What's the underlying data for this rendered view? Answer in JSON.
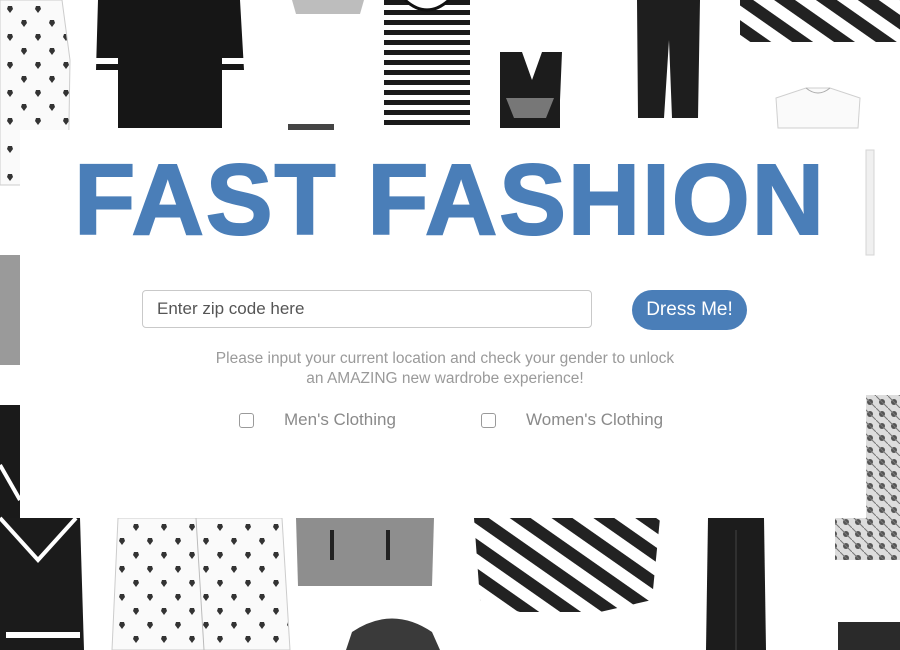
{
  "hero": {
    "title": "FAST FASHION"
  },
  "search": {
    "placeholder": "Enter zip code here",
    "value": "",
    "submit_label": "Dress Me!"
  },
  "description": {
    "line1": "Please input your current location and check your gender to unlock",
    "line2": "an AMAZING new wardrobe experience!"
  },
  "options": [
    {
      "label": "Men's Clothing",
      "checked": false
    },
    {
      "label": "Women's Clothing",
      "checked": false
    }
  ],
  "colors": {
    "accent": "#4a7eb8",
    "muted_text": "#9a9a9a"
  }
}
